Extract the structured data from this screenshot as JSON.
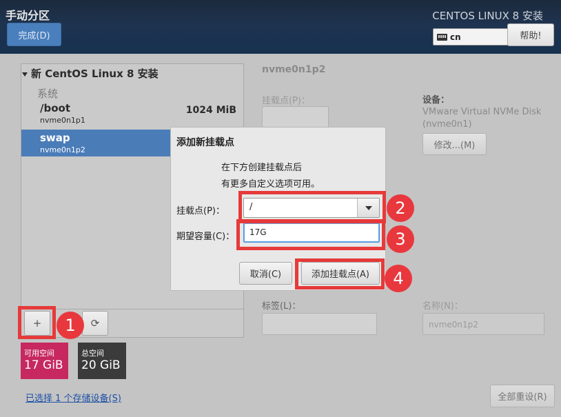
{
  "header": {
    "page_title": "手动分区",
    "done_label": "完成(D)",
    "product_title": "CENTOS LINUX 8 安装",
    "keyboard_layout": "cn",
    "help_label": "帮助!"
  },
  "left_panel": {
    "install_heading": "新 CentOS Linux 8 安装",
    "system_label": "系统",
    "mount_points": [
      {
        "name": "/boot",
        "device": "nvme0n1p1",
        "size": "1024 MiB",
        "selected": false
      },
      {
        "name": "swap",
        "device": "nvme0n1p2",
        "size": "",
        "selected": true
      }
    ],
    "toolbar": {
      "add_icon": "+",
      "refresh_icon": "⟳"
    },
    "available_space": {
      "label": "可用空间",
      "value": "17 GiB",
      "color": "#c6285f"
    },
    "total_space": {
      "label": "总空间",
      "value": "20 GiB",
      "color": "#3b3b3b"
    },
    "storage_link": "已选择 1 个存储设备(S)"
  },
  "detail": {
    "partition_title": "nvme0n1p2",
    "mount_point_label": "挂载点(P)：",
    "device_label": "设备：",
    "device_desc": "VMware Virtual NVMe Disk (nvme0n1)",
    "modify_label": "修改...(M)",
    "tag_label": "标签(L)：",
    "name_label": "名称(N)：",
    "name_value": "nvme0n1p2",
    "reset_label": "全部重设(R)"
  },
  "dialog": {
    "title": "添加新挂载点",
    "desc_line1": "在下方创建挂载点后",
    "desc_line2": "有更多自定义选项可用。",
    "mount_label": "挂载点(P)：",
    "mount_value": "/",
    "size_label": "期望容量(C)：",
    "size_value": "17G",
    "cancel_label": "取消(C)",
    "add_label": "添加挂载点(A)"
  },
  "annotations": {
    "step1": "1",
    "step2": "2",
    "step3": "3",
    "step4": "4",
    "color": "#e63a3a"
  }
}
